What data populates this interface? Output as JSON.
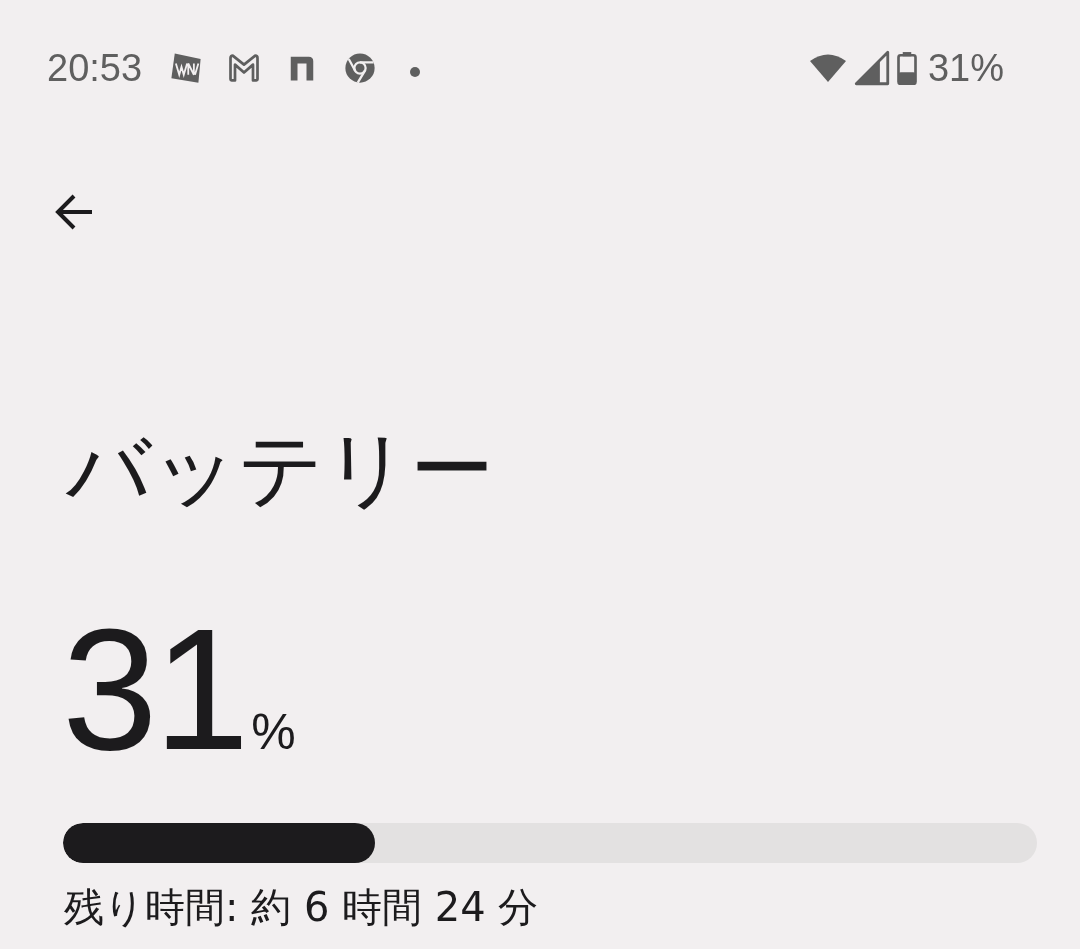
{
  "status_bar": {
    "time": "20:53",
    "notification_icons": [
      {
        "kind": "news"
      },
      {
        "kind": "mail"
      },
      {
        "kind": "n"
      },
      {
        "kind": "browser"
      },
      {
        "kind": "dot"
      }
    ],
    "battery_text": "31%"
  },
  "back_button": {
    "kind": "back"
  },
  "title": "バッテリー",
  "battery": {
    "value": "31",
    "unit": "%",
    "level": 0.32,
    "remaining": "残り時間: 約 6 時間 24 分"
  }
}
